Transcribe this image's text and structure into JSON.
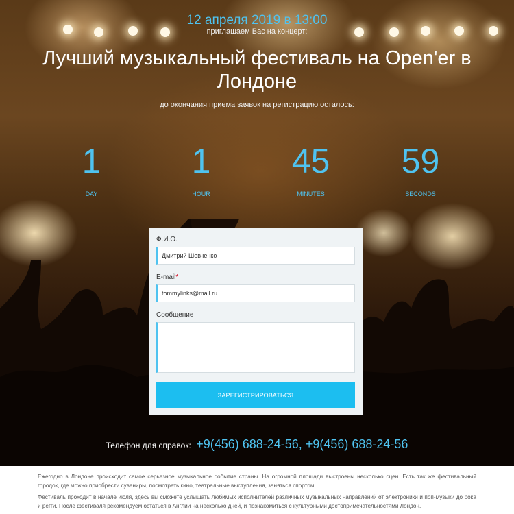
{
  "event": {
    "date": "12 апреля 2019 в 13:00",
    "invite": "приглашаем Вас на концерт:",
    "title": "Лучший музыкальный фестиваль на Open'er в Лондоне",
    "subtitle": "до окончания приема заявок на регистрацию осталось:"
  },
  "countdown": [
    {
      "value": "1",
      "label": "DAY"
    },
    {
      "value": "1",
      "label": "HOUR"
    },
    {
      "value": "45",
      "label": "MINUTES"
    },
    {
      "value": "59",
      "label": "SECONDS"
    }
  ],
  "form": {
    "name_label": "Ф.И.О.",
    "name_value": "Дмитрий Шевченко",
    "email_label": "E-mail",
    "email_required_mark": "*",
    "email_value": "tommylinks@mail.ru",
    "message_label": "Сообщение",
    "message_value": "",
    "submit_label": "ЗАРЕГИСТРИРОВАТЬСЯ"
  },
  "contact": {
    "phone_label": "Телефон для справок:",
    "phones": "+9(456) 688-24-56, +9(456) 688-24-56"
  },
  "info": {
    "paragraph1": "Ежегодно в Лондоне происходит самое серьезное музыкальное событие страны. На огромной площади выстроены несколько сцен. Есть так же фестивальный городок, где можно приобрести сувениры, посмотреть кино, театральные выступления, заняться спортом.",
    "paragraph2": "Фестиваль проходит в начале июля, здесь вы сможете услышать любимых исполнителей различных музыкальных направлений от электроники и поп-музыки до рока и регги. После фестиваля рекомендуем остаться в Англии на несколько дней, и познакомиться с культурными достопримечательностями Лондон."
  },
  "colors": {
    "accent": "#4fc3f0",
    "button": "#1cbef0",
    "form_bg": "#eff3f5"
  }
}
